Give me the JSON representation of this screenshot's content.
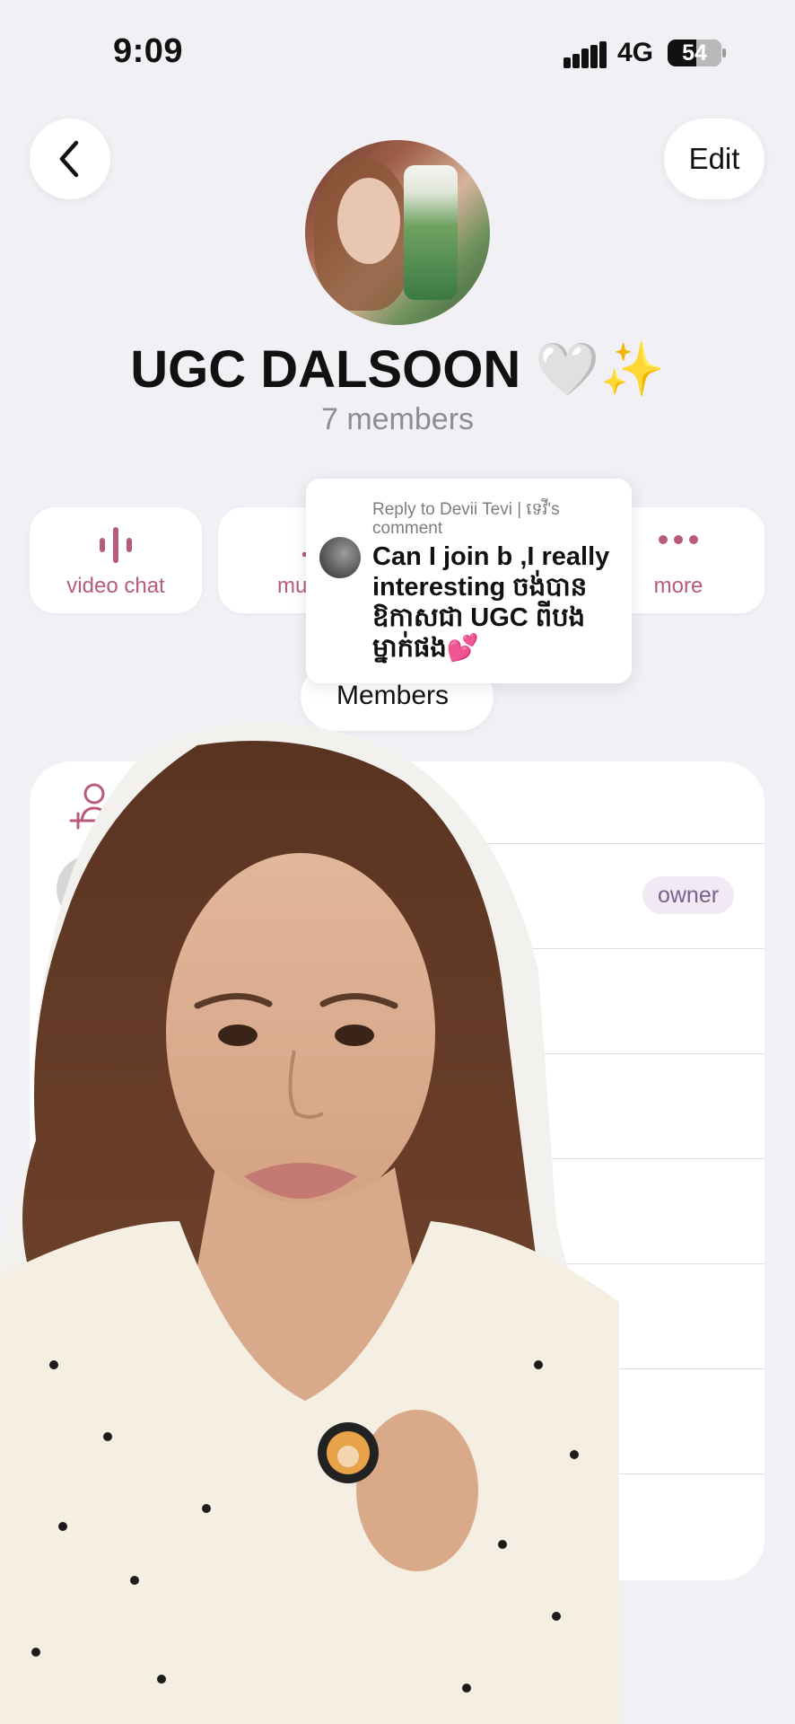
{
  "status_bar": {
    "time": "9:09",
    "network": "4G",
    "battery": "54"
  },
  "header": {
    "back_icon": "chevron-left-icon",
    "edit_label": "Edit"
  },
  "group": {
    "name": "UGC DALSOON 🤍✨",
    "member_count": "7 members"
  },
  "actions": [
    {
      "label": "video chat",
      "icon": "waveform-icon"
    },
    {
      "label": "mu",
      "icon": "bell-icon"
    },
    {
      "label": "more",
      "icon": "ellipsis-icon"
    }
  ],
  "reply_card": {
    "header": "Reply to Devii Tevi | ទេវី's comment",
    "text": "Can I join b ,I really interesting ចង់បានឱកាសជា UGC ពីបងម្នាក់ផង💕"
  },
  "members_section": {
    "label": "Members",
    "owner_badge": "owner"
  },
  "colors": {
    "accent": "#b85a7e",
    "background": "#f0f0f5",
    "badge_text": "#7b5f8b"
  }
}
